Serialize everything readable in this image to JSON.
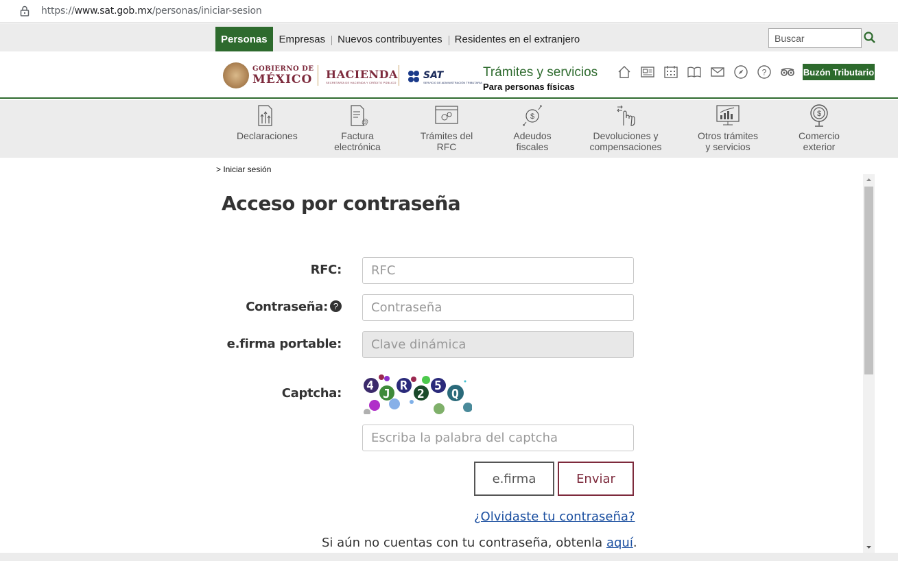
{
  "browser": {
    "url_prefix": "https://",
    "url_domain": "www.sat.gob.mx",
    "url_path": "/personas/iniciar-sesion"
  },
  "topnav": {
    "tabs": [
      "Personas",
      "Empresas",
      "Nuevos contribuyentes",
      "Residentes en el extranjero"
    ],
    "search_placeholder": "Buscar"
  },
  "header": {
    "gob_line1": "GOBIERNO DE",
    "gob_line2": "MÉXICO",
    "hacienda": "HACIENDA",
    "hacienda_sub": "SECRETARÍA DE HACIENDA Y CRÉDITO PÚBLICO",
    "sat": "SAT",
    "sat_sub": "SERVICIO DE ADMINISTRACIÓN TRIBUTARIA",
    "title": "Trámites y servicios",
    "subtitle": "Para personas físicas",
    "icons": [
      "home-icon",
      "newspaper-icon",
      "calendar-icon",
      "book-icon",
      "mail-icon",
      "compass-icon",
      "help-icon",
      "glasses-icon"
    ],
    "buzon": "Buzón Tributario"
  },
  "categories": [
    {
      "line1": "Declaraciones",
      "line2": "",
      "icon": "declaraciones-icon"
    },
    {
      "line1": "Factura",
      "line2": "electrónica",
      "icon": "factura-icon"
    },
    {
      "line1": "Trámites del",
      "line2": "RFC",
      "icon": "rfc-icon"
    },
    {
      "line1": "Adeudos",
      "line2": "fiscales",
      "icon": "adeudos-icon"
    },
    {
      "line1": "Devoluciones y",
      "line2": "compensaciones",
      "icon": "devoluciones-icon"
    },
    {
      "line1": "Otros trámites",
      "line2": "y servicios",
      "icon": "otros-icon"
    },
    {
      "line1": "Comercio",
      "line2": "exterior",
      "icon": "comercio-icon"
    }
  ],
  "breadcrumb": "> Iniciar sesión",
  "form": {
    "title": "Acceso por contraseña",
    "rfc_label": "RFC:",
    "rfc_placeholder": "RFC",
    "password_label": "Contraseña:",
    "password_placeholder": "Contraseña",
    "efirma_label": "e.firma portable:",
    "efirma_placeholder": "Clave dinámica",
    "captcha_label": "Captcha:",
    "captcha_text": "4JR25Q",
    "captcha_placeholder": "Escriba la palabra del captcha",
    "btn_efirma": "e.firma",
    "btn_enviar": "Enviar",
    "forgot": "¿Olvidaste tu contraseña?",
    "noacct_text": "Si aún no cuentas con tu contraseña, obtenla",
    "noacct_link": "aquí",
    "noacct_end": "."
  },
  "colors": {
    "green": "#2d6a2d",
    "guinda": "#7d2a3c",
    "link": "#1b4fa0"
  }
}
